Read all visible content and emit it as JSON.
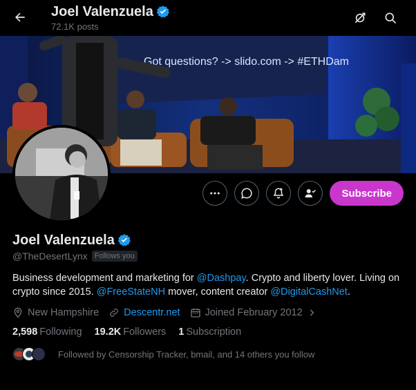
{
  "header": {
    "name": "Joel Valenzuela",
    "posts": "72.1K posts",
    "back_icon": "arrow-left-icon",
    "right_icons": [
      "hide-replies-icon",
      "search-icon"
    ]
  },
  "banner": {
    "slide_text": "Got questions? -> slido.com -> #ETHDam"
  },
  "actions": {
    "more_icon": "more-dots-icon",
    "message_icon": "message-icon",
    "notify_icon": "bell-plus-icon",
    "follow_icon": "person-check-icon",
    "subscribe_label": "Subscribe"
  },
  "profile": {
    "name": "Joel Valenzuela",
    "handle": "@TheDesertLynx",
    "follows_you": "Follows you",
    "bio": {
      "p1": "Business development and marketing for ",
      "link1": "@Dashpay",
      "p2": ". Crypto and liberty lover. Living on crypto since 2015. ",
      "link2": "@FreeStateNH",
      "p3": " mover, content creator ",
      "link3": "@DigitalCashNet",
      "p4": "."
    },
    "location": "New Hampshire",
    "website": "Descentr.net",
    "joined": "Joined February 2012"
  },
  "stats": {
    "following_count": "2,598",
    "following_label": "Following",
    "followers_count": "19.2K",
    "followers_label": "Followers",
    "subscription_count": "1",
    "subscription_label": "Subscription"
  },
  "followed_by": "Followed by Censorship Tracker, bmail, and 14 others you follow",
  "colors": {
    "accent": "#1d9bf0",
    "subscribe": "#c936cc",
    "verified": "#1d9bf0"
  }
}
